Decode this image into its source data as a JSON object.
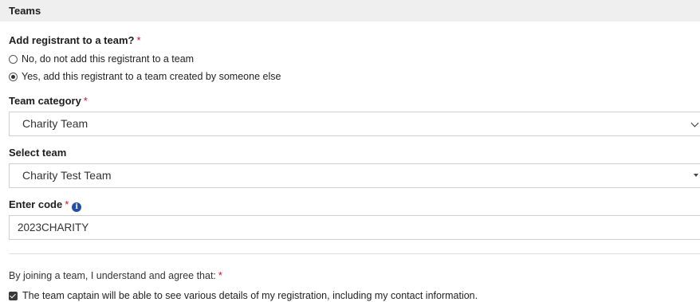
{
  "section": {
    "title": "Teams"
  },
  "add_team": {
    "question": "Add registrant to a team?",
    "required_mark": "*",
    "options": [
      {
        "label": "No, do not add this registrant to a team",
        "selected": false
      },
      {
        "label": "Yes, add this registrant to a team created by someone else",
        "selected": true
      }
    ]
  },
  "team_category": {
    "label": "Team category",
    "required_mark": "*",
    "value": "Charity Team"
  },
  "select_team": {
    "label": "Select team",
    "value": "Charity Test Team"
  },
  "enter_code": {
    "label": "Enter code",
    "required_mark": "*",
    "info_icon": "info-icon",
    "value": "2023CHARITY"
  },
  "agreement": {
    "text": "By joining a team, I understand and agree that:",
    "required_mark": "*",
    "checkbox_label": "The team captain will be able to see various details of my registration, including my contact information.",
    "checked": true
  }
}
